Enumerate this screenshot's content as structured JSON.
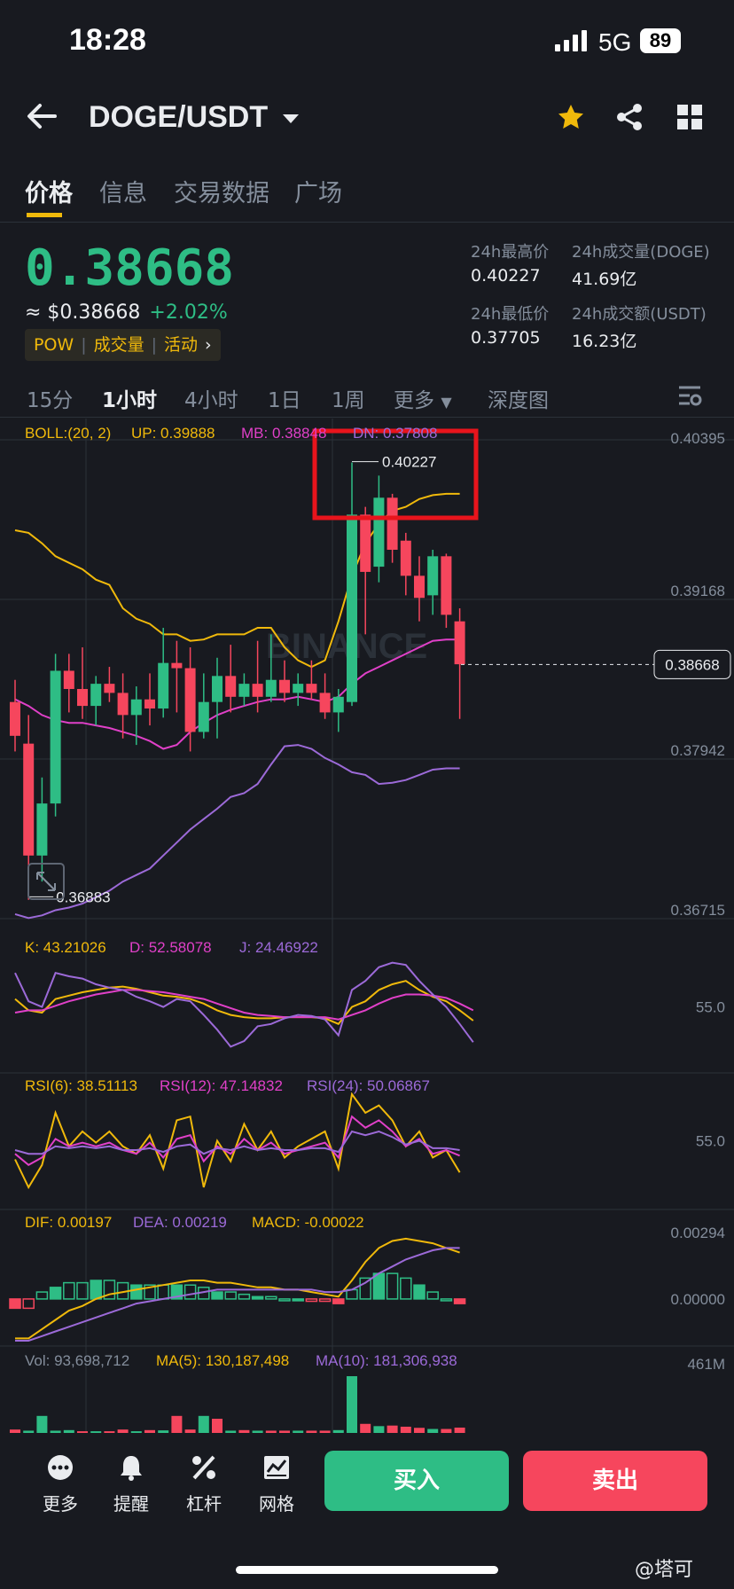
{
  "status": {
    "time": "18:28",
    "network": "5G",
    "battery": "89"
  },
  "header": {
    "pair": "DOGE/USDT",
    "back_icon": "arrow-left-icon",
    "fav_icon": "star-icon",
    "share_icon": "share-icon",
    "grid_icon": "grid-icon",
    "accent": "#f0b90b"
  },
  "tabs": [
    {
      "label": "价格",
      "active": true
    },
    {
      "label": "信息",
      "active": false
    },
    {
      "label": "交易数据",
      "active": false
    },
    {
      "label": "广场",
      "active": false
    }
  ],
  "ticker": {
    "last_price": "0.38668",
    "usd_price": "≈ $0.38668",
    "change": "+2.02%",
    "tags": [
      "POW",
      "成交量",
      "活动"
    ],
    "high_label": "24h最高价",
    "high": "0.40227",
    "vol_base_label": "24h成交量(DOGE)",
    "vol_base": "41.69亿",
    "low_label": "24h最低价",
    "low": "0.37705",
    "vol_quote_label": "24h成交额(USDT)",
    "vol_quote": "16.23亿",
    "up_color": "#2ebd85",
    "down_color": "#f6465d"
  },
  "intervals": [
    "15分",
    "1小时",
    "4小时",
    "1日",
    "1周",
    "更多",
    "深度图"
  ],
  "active_interval": "1小时",
  "chart_data": [
    {
      "type": "candlestick",
      "boll": {
        "label": "BOLL:(20, 2)",
        "up": "UP: 0.39888",
        "mb": "MB: 0.38848",
        "dn": "DN: 0.37808"
      },
      "y_ticks": [
        "0.40395",
        "0.39168",
        "0.37942",
        "0.36715"
      ],
      "ylim": [
        0.36715,
        0.40395
      ],
      "last_price_label": "0.38668",
      "max_label": "0.40227",
      "min_label": "0.36883",
      "candles": [
        {
          "o": 0.3838,
          "h": 0.3855,
          "l": 0.38,
          "c": 0.3812
        },
        {
          "o": 0.3806,
          "h": 0.3828,
          "l": 0.3686,
          "c": 0.372
        },
        {
          "o": 0.372,
          "h": 0.378,
          "l": 0.37,
          "c": 0.376
        },
        {
          "o": 0.376,
          "h": 0.3875,
          "l": 0.375,
          "c": 0.3862
        },
        {
          "o": 0.3862,
          "h": 0.3875,
          "l": 0.383,
          "c": 0.3848
        },
        {
          "o": 0.3848,
          "h": 0.388,
          "l": 0.3825,
          "c": 0.3835
        },
        {
          "o": 0.3835,
          "h": 0.3858,
          "l": 0.382,
          "c": 0.3852
        },
        {
          "o": 0.3852,
          "h": 0.3865,
          "l": 0.3838,
          "c": 0.3845
        },
        {
          "o": 0.3845,
          "h": 0.386,
          "l": 0.381,
          "c": 0.3828
        },
        {
          "o": 0.3828,
          "h": 0.385,
          "l": 0.3805,
          "c": 0.384
        },
        {
          "o": 0.384,
          "h": 0.386,
          "l": 0.382,
          "c": 0.3833
        },
        {
          "o": 0.3833,
          "h": 0.3895,
          "l": 0.3826,
          "c": 0.3868
        },
        {
          "o": 0.3868,
          "h": 0.3885,
          "l": 0.383,
          "c": 0.3864
        },
        {
          "o": 0.3864,
          "h": 0.388,
          "l": 0.38,
          "c": 0.3815
        },
        {
          "o": 0.3815,
          "h": 0.386,
          "l": 0.381,
          "c": 0.3838
        },
        {
          "o": 0.3838,
          "h": 0.3872,
          "l": 0.381,
          "c": 0.3858
        },
        {
          "o": 0.3858,
          "h": 0.3882,
          "l": 0.383,
          "c": 0.3842
        },
        {
          "o": 0.3842,
          "h": 0.386,
          "l": 0.3835,
          "c": 0.3852
        },
        {
          "o": 0.3852,
          "h": 0.3885,
          "l": 0.383,
          "c": 0.3842
        },
        {
          "o": 0.3842,
          "h": 0.389,
          "l": 0.3838,
          "c": 0.3855
        },
        {
          "o": 0.3855,
          "h": 0.387,
          "l": 0.3838,
          "c": 0.3845
        },
        {
          "o": 0.3845,
          "h": 0.386,
          "l": 0.3835,
          "c": 0.3852
        },
        {
          "o": 0.3852,
          "h": 0.387,
          "l": 0.384,
          "c": 0.3845
        },
        {
          "o": 0.3845,
          "h": 0.386,
          "l": 0.3825,
          "c": 0.383
        },
        {
          "o": 0.383,
          "h": 0.3848,
          "l": 0.3815,
          "c": 0.3842
        },
        {
          "o": 0.3838,
          "h": 0.4022,
          "l": 0.3835,
          "c": 0.3982
        },
        {
          "o": 0.3982,
          "h": 0.3988,
          "l": 0.389,
          "c": 0.3938
        },
        {
          "o": 0.3942,
          "h": 0.4012,
          "l": 0.393,
          "c": 0.3995
        },
        {
          "o": 0.3995,
          "h": 0.3998,
          "l": 0.3945,
          "c": 0.3955
        },
        {
          "o": 0.3962,
          "h": 0.3968,
          "l": 0.392,
          "c": 0.3935
        },
        {
          "o": 0.3935,
          "h": 0.395,
          "l": 0.39,
          "c": 0.3918
        },
        {
          "o": 0.392,
          "h": 0.3955,
          "l": 0.3905,
          "c": 0.395
        },
        {
          "o": 0.395,
          "h": 0.3952,
          "l": 0.3895,
          "c": 0.3905
        },
        {
          "o": 0.39,
          "h": 0.391,
          "l": 0.3825,
          "c": 0.3867
        }
      ],
      "series": [
        {
          "name": "UP",
          "color": "#f0b90b",
          "values": [
            0.397,
            0.3968,
            0.396,
            0.395,
            0.3945,
            0.394,
            0.3932,
            0.3928,
            0.391,
            0.3902,
            0.3898,
            0.389,
            0.389,
            0.3885,
            0.3886,
            0.389,
            0.389,
            0.389,
            0.3895,
            0.3895,
            0.388,
            0.387,
            0.3865,
            0.387,
            0.39,
            0.3935,
            0.396,
            0.3975,
            0.3985,
            0.3988,
            0.3994,
            0.3997,
            0.3998,
            0.3998
          ]
        },
        {
          "name": "MB",
          "color": "#e040c8",
          "values": [
            0.384,
            0.3835,
            0.3828,
            0.3824,
            0.3822,
            0.3822,
            0.382,
            0.3818,
            0.3815,
            0.3812,
            0.3808,
            0.3802,
            0.3805,
            0.3815,
            0.3822,
            0.3828,
            0.3832,
            0.3835,
            0.3838,
            0.384,
            0.384,
            0.3842,
            0.384,
            0.3838,
            0.3842,
            0.3852,
            0.386,
            0.3865,
            0.387,
            0.3875,
            0.388,
            0.3885,
            0.3886,
            0.3886
          ]
        },
        {
          "name": "DN",
          "color": "#9c6ad8",
          "values": [
            0.3675,
            0.3672,
            0.3674,
            0.3678,
            0.368,
            0.3683,
            0.3688,
            0.3693,
            0.37,
            0.3705,
            0.371,
            0.372,
            0.373,
            0.374,
            0.3748,
            0.3756,
            0.3765,
            0.3768,
            0.3775,
            0.379,
            0.3804,
            0.3805,
            0.3802,
            0.3795,
            0.379,
            0.3784,
            0.3782,
            0.3775,
            0.3776,
            0.3778,
            0.3782,
            0.3786,
            0.3787,
            0.3787
          ]
        }
      ]
    },
    {
      "type": "line",
      "title": "KDJ",
      "labels": {
        "k": "K: 43.21026",
        "d": "D: 52.58078",
        "j": "J: 24.46922"
      },
      "y_tick": "55.0",
      "ylim": [
        0,
        100
      ],
      "series": [
        {
          "name": "K",
          "color": "#f0b90b",
          "values": [
            62,
            52,
            50,
            62,
            65,
            68,
            70,
            72,
            73,
            71,
            68,
            65,
            64,
            62,
            58,
            52,
            48,
            46,
            45,
            45,
            46,
            46,
            46,
            45,
            40,
            55,
            60,
            70,
            75,
            78,
            70,
            64,
            60,
            52,
            43
          ]
        },
        {
          "name": "D",
          "color": "#e040c8",
          "values": [
            50,
            52,
            52,
            56,
            60,
            63,
            66,
            68,
            70,
            70,
            69,
            68,
            66,
            64,
            62,
            58,
            54,
            50,
            48,
            47,
            46,
            46,
            46,
            46,
            44,
            48,
            52,
            58,
            63,
            66,
            66,
            65,
            63,
            58,
            52
          ]
        },
        {
          "name": "J",
          "color": "#9c6ad8",
          "values": [
            85,
            60,
            55,
            85,
            82,
            80,
            75,
            72,
            70,
            64,
            60,
            55,
            62,
            60,
            48,
            35,
            20,
            25,
            38,
            40,
            45,
            48,
            47,
            44,
            30,
            70,
            78,
            90,
            94,
            92,
            78,
            66,
            55,
            40,
            24
          ]
        }
      ]
    },
    {
      "type": "line",
      "title": "RSI",
      "labels": {
        "r6": "RSI(6): 38.51113",
        "r12": "RSI(12): 47.14832",
        "r24": "RSI(24): 50.06867"
      },
      "y_tick": "55.0",
      "ylim": [
        20,
        80
      ],
      "series": [
        {
          "name": "RSI(6)",
          "color": "#f0b90b",
          "values": [
            45,
            30,
            42,
            70,
            52,
            60,
            54,
            60,
            52,
            48,
            58,
            40,
            66,
            68,
            30,
            55,
            44,
            64,
            50,
            60,
            46,
            52,
            56,
            60,
            40,
            80,
            70,
            74,
            66,
            52,
            60,
            46,
            50,
            38
          ]
        },
        {
          "name": "RSI(12)",
          "color": "#e040c8",
          "values": [
            48,
            42,
            46,
            56,
            52,
            54,
            52,
            54,
            50,
            48,
            54,
            46,
            56,
            58,
            44,
            52,
            48,
            56,
            50,
            54,
            48,
            50,
            52,
            54,
            46,
            68,
            62,
            66,
            60,
            52,
            56,
            48,
            50,
            47
          ]
        },
        {
          "name": "RSI(24)",
          "color": "#9c6ad8",
          "values": [
            50,
            48,
            48,
            52,
            51,
            52,
            51,
            52,
            50,
            50,
            51,
            49,
            52,
            53,
            48,
            51,
            50,
            52,
            50,
            51,
            50,
            50,
            51,
            51,
            49,
            60,
            58,
            60,
            57,
            53,
            55,
            51,
            51,
            50
          ]
        }
      ]
    },
    {
      "type": "line",
      "title": "MACD",
      "labels": {
        "dif": "DIF: 0.00197",
        "dea": "DEA: 0.00219",
        "macd": "MACD: -0.00022"
      },
      "y_ticks": [
        "0.00294",
        "0.00000"
      ],
      "ylim": [
        -0.0018,
        0.00294
      ],
      "series": [
        {
          "name": "DIF",
          "color": "#f0b90b",
          "values": [
            -0.0017,
            -0.0017,
            -0.0013,
            -0.0009,
            -0.0005,
            -0.0003,
            0.0,
            0.0002,
            0.0003,
            0.0004,
            0.0005,
            0.0006,
            0.0007,
            0.0008,
            0.0008,
            0.0007,
            0.0007,
            0.0006,
            0.0005,
            0.0005,
            0.0004,
            0.0004,
            0.0003,
            0.0002,
            0.0001,
            0.0008,
            0.0016,
            0.0022,
            0.0025,
            0.0026,
            0.0025,
            0.0024,
            0.0022,
            0.002
          ]
        },
        {
          "name": "DEA",
          "color": "#9c6ad8",
          "values": [
            -0.0018,
            -0.0018,
            -0.0016,
            -0.0014,
            -0.0012,
            -0.001,
            -0.0008,
            -0.0006,
            -0.0004,
            -0.0002,
            -0.0001,
            0.0,
            0.0001,
            0.0002,
            0.0003,
            0.0004,
            0.0004,
            0.0004,
            0.0004,
            0.0004,
            0.0004,
            0.0004,
            0.0004,
            0.0003,
            0.0003,
            0.0004,
            0.0007,
            0.0011,
            0.0014,
            0.0017,
            0.0019,
            0.0021,
            0.0022,
            0.0022
          ]
        },
        {
          "name": "MACD",
          "color": "#2ebd85",
          "values": [
            -0.0004,
            -0.0004,
            0.0003,
            0.0005,
            0.0007,
            0.0007,
            0.0008,
            0.0008,
            0.0007,
            0.0006,
            0.0006,
            0.0006,
            0.0006,
            0.0006,
            0.0005,
            0.0003,
            0.0003,
            0.0002,
            0.0001,
            0.0001,
            0.0,
            0.0,
            -0.0001,
            -0.0001,
            -0.0002,
            0.0004,
            0.0009,
            0.0011,
            0.0011,
            0.0009,
            0.0006,
            0.0003,
            0.0,
            -0.0002
          ]
        }
      ]
    },
    {
      "type": "bar",
      "title": "Volume",
      "labels": {
        "vol": "Vol: 93,698,712",
        "ma5": "MA(5): 130,187,498",
        "ma10": "MA(10): 181,306,938"
      },
      "y_tick": "461M",
      "values": [
        60,
        40,
        300,
        40,
        50,
        30,
        30,
        30,
        60,
        30,
        50,
        45,
        300,
        60,
        300,
        250,
        40,
        50,
        40,
        40,
        40,
        40,
        40,
        40,
        50,
        1000,
        160,
        120,
        130,
        110,
        90,
        70,
        70,
        94
      ],
      "up": [
        false,
        true,
        true,
        true,
        true,
        false,
        true,
        false,
        false,
        true,
        false,
        true,
        false,
        false,
        true,
        false,
        true,
        false,
        true,
        false,
        false,
        true,
        false,
        false,
        true,
        true,
        false,
        true,
        false,
        false,
        false,
        true,
        false,
        false
      ]
    }
  ],
  "bottom_nav": [
    {
      "label": "更多",
      "icon": "dots-icon"
    },
    {
      "label": "提醒",
      "icon": "bell-icon"
    },
    {
      "label": "杠杆",
      "icon": "percent-icon"
    },
    {
      "label": "网格",
      "icon": "grid-chart-icon"
    }
  ],
  "buy_label": "买入",
  "sell_label": "卖出",
  "watermark": "@塔可"
}
